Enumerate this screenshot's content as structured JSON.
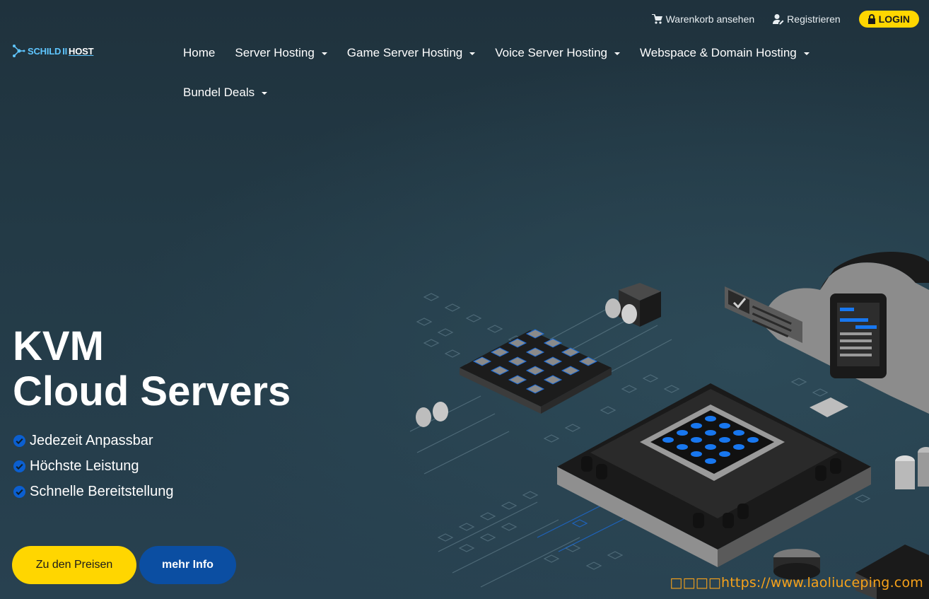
{
  "topbar": {
    "cart_label": "Warenkorb ansehen",
    "register_label": "Registrieren",
    "login_label": "LOGIN"
  },
  "logo": {
    "part1": "SCHILD",
    "part2": "II",
    "part3": "HOST"
  },
  "nav": {
    "items": [
      {
        "label": "Home"
      },
      {
        "label": "Server Hosting"
      },
      {
        "label": "Game Server Hosting"
      },
      {
        "label": "Voice Server Hosting"
      },
      {
        "label": "Webspace & Domain Hosting"
      },
      {
        "label": "Bundel Deals"
      }
    ]
  },
  "hero": {
    "title_line1": "KVM",
    "title_line2": "Cloud Servers",
    "features": [
      "Jedezeit Anpassbar",
      "Höchste Leistung",
      "Schnelle Bereitstellung"
    ],
    "primary_button": "Zu den Preisen",
    "secondary_button": "mehr Info"
  },
  "watermark": "□□□□https://www.laoliuceping.com",
  "colors": {
    "accent_yellow": "#ffd600",
    "accent_blue": "#0b4ea2",
    "background": "#233843"
  }
}
